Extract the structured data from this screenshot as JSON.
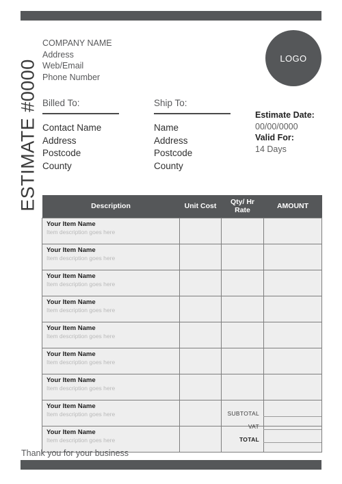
{
  "document": {
    "vertical_title": "ESTIMATE #0000",
    "footer_note": "Thank you for your business"
  },
  "company": {
    "name": "COMPANY NAME",
    "address": "Address",
    "web_email": "Web/Email",
    "phone": "Phone Number"
  },
  "logo": {
    "label": "LOGO"
  },
  "billed_to": {
    "title": "Billed To:",
    "line1": "Contact Name",
    "line2": "Address",
    "line3": "Postcode",
    "line4": "County"
  },
  "ship_to": {
    "title": "Ship To:",
    "line1": "Name",
    "line2": "Address",
    "line3": "Postcode",
    "line4": "County"
  },
  "estimate_meta": {
    "date_label": "Estimate Date:",
    "date_value": "00/00/0000",
    "valid_label": "Valid For:",
    "valid_value": "14 Days"
  },
  "table": {
    "headers": {
      "description": "Description",
      "unit_cost": "Unit Cost",
      "qty_hr_rate": "Qty/ Hr\nRate",
      "qty_hr_rate_line1": "Qty/ Hr",
      "qty_hr_rate_line2": "Rate",
      "amount": "AMOUNT"
    },
    "rows": [
      {
        "name": "Your Item Name",
        "description": "Item description goes here",
        "unit_cost": "",
        "qty": "",
        "amount": ""
      },
      {
        "name": "Your Item Name",
        "description": "Item description goes here",
        "unit_cost": "",
        "qty": "",
        "amount": ""
      },
      {
        "name": "Your Item Name",
        "description": "Item description goes here",
        "unit_cost": "",
        "qty": "",
        "amount": ""
      },
      {
        "name": "Your Item Name",
        "description": "Item description goes here",
        "unit_cost": "",
        "qty": "",
        "amount": ""
      },
      {
        "name": "Your Item Name",
        "description": "Item description goes here",
        "unit_cost": "",
        "qty": "",
        "amount": ""
      },
      {
        "name": "Your Item Name",
        "description": "Item description goes here",
        "unit_cost": "",
        "qty": "",
        "amount": ""
      },
      {
        "name": "Your Item Name",
        "description": "Item description goes here",
        "unit_cost": "",
        "qty": "",
        "amount": ""
      },
      {
        "name": "Your Item Name",
        "description": "Item description goes here",
        "unit_cost": "",
        "qty": "",
        "amount": ""
      },
      {
        "name": "Your Item Name",
        "description": "Item description goes here",
        "unit_cost": "",
        "qty": "",
        "amount": ""
      }
    ]
  },
  "totals": [
    {
      "label": "SUBTOTAL",
      "value": "",
      "bold": false
    },
    {
      "label": "VAT",
      "value": "",
      "bold": false
    },
    {
      "label": "TOTAL",
      "value": "",
      "bold": true
    }
  ],
  "colors": {
    "accent_dark": "#555759",
    "table_cell_bg": "#eeeeee",
    "cell_border": "#7d7d7d",
    "muted_text": "#b9b9b9",
    "body_text": "#58595b"
  }
}
